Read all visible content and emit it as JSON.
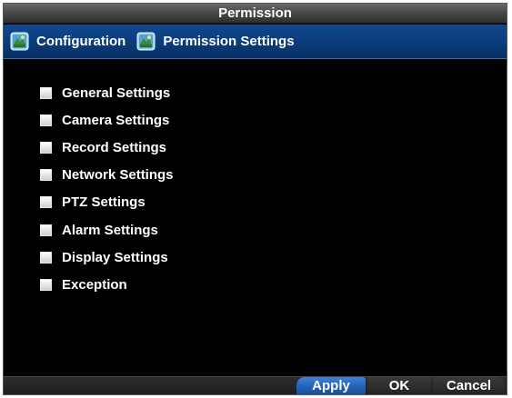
{
  "window": {
    "title": "Permission"
  },
  "breadcrumb": {
    "items": [
      {
        "label": "Configuration",
        "icon": "settings-panel-icon"
      },
      {
        "label": "Permission Settings",
        "icon": "settings-panel-icon"
      }
    ]
  },
  "permissions": [
    {
      "label": "General Settings",
      "checked": false
    },
    {
      "label": "Camera Settings",
      "checked": false
    },
    {
      "label": "Record Settings",
      "checked": false
    },
    {
      "label": "Network Settings",
      "checked": false
    },
    {
      "label": "PTZ Settings",
      "checked": false
    },
    {
      "label": "Alarm Settings",
      "checked": false
    },
    {
      "label": "Display Settings",
      "checked": false
    },
    {
      "label": "Exception",
      "checked": false
    }
  ],
  "buttons": {
    "apply": "Apply",
    "ok": "OK",
    "cancel": "Cancel"
  },
  "colors": {
    "background": "#000000",
    "breadcrumb_bar": "#0b3a78",
    "selected_button": "#2262b8",
    "text": "#ffffff"
  }
}
